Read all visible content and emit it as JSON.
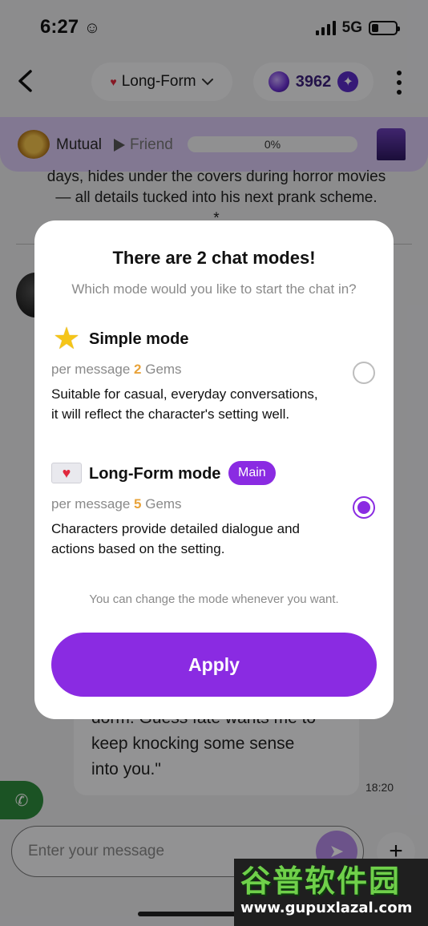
{
  "status_bar": {
    "time": "6:27",
    "time_icon": "smiley-icon",
    "network": "5G"
  },
  "header": {
    "mode_label": "Long-Form",
    "gems": "3962"
  },
  "relationship": {
    "current": "Mutual",
    "next": "Friend",
    "progress_text": "0%",
    "progress": 0
  },
  "chat": {
    "text_lines": [
      "days, hides under the covers during horror movies",
      "— all details tucked into his next prank scheme.",
      "*"
    ],
    "bubble_lines": [
      "dorm. Guess fate wants me to",
      "keep knocking some sense",
      "into you.\""
    ],
    "bubble_time": "18:20",
    "input_placeholder": "Enter your message"
  },
  "modal": {
    "title": "There are 2 chat modes!",
    "subtitle": "Which mode would you like to start the chat in?",
    "modes": [
      {
        "icon": "star-icon",
        "name": "Simple mode",
        "price_prefix": "per message",
        "price_value": "2",
        "price_suffix": "Gems",
        "description_lines": [
          "Suitable for casual, everyday conversations,",
          "it will reflect the character's setting well."
        ],
        "selected": false
      },
      {
        "icon": "heart-envelope-icon",
        "name": "Long-Form mode",
        "tag": "Main",
        "price_prefix": "per message",
        "price_value": "5",
        "price_suffix": "Gems",
        "description_lines": [
          "Characters provide detailed dialogue and",
          "actions based on the setting."
        ],
        "selected": true
      }
    ],
    "note": "You can change the mode whenever you want.",
    "apply_label": "Apply"
  },
  "watermark": {
    "brand": "谷普软件园",
    "url": "www.gupuxlazal.com"
  },
  "colors": {
    "accent": "#8a2be2",
    "gem_number": "#e8a33a",
    "call_green": "#2e8b3c"
  }
}
